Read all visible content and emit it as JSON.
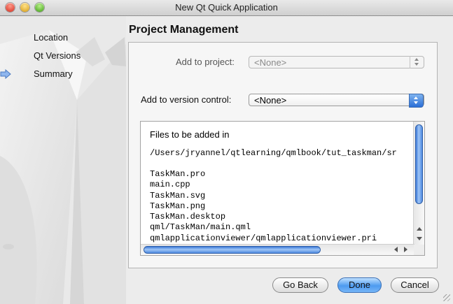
{
  "window": {
    "title": "New Qt Quick Application"
  },
  "nav": {
    "items": [
      {
        "label": "Location"
      },
      {
        "label": "Qt Versions"
      },
      {
        "label": "Summary",
        "current": true
      }
    ]
  },
  "page": {
    "title": "Project Management"
  },
  "form": {
    "add_to_project": {
      "label": "Add to project:",
      "value": "<None>",
      "enabled": false
    },
    "version_control": {
      "label": "Add to version control:",
      "value": "<None>",
      "enabled": true
    }
  },
  "files": {
    "heading": "Files to be added in",
    "path": "/Users/jryannel/qtlearning/qmlbook/tut_taskman/sr",
    "list": [
      "TaskMan.pro",
      "main.cpp",
      "TaskMan.svg",
      "TaskMan.png",
      "TaskMan.desktop",
      "qml/TaskMan/main.qml",
      "qmlapplicationviewer/qmlapplicationviewer.pri"
    ]
  },
  "buttons": {
    "back": "Go Back",
    "done": "Done",
    "cancel": "Cancel"
  },
  "colors": {
    "accent": "#3b7fe0",
    "panel": "#f6f6f6"
  }
}
